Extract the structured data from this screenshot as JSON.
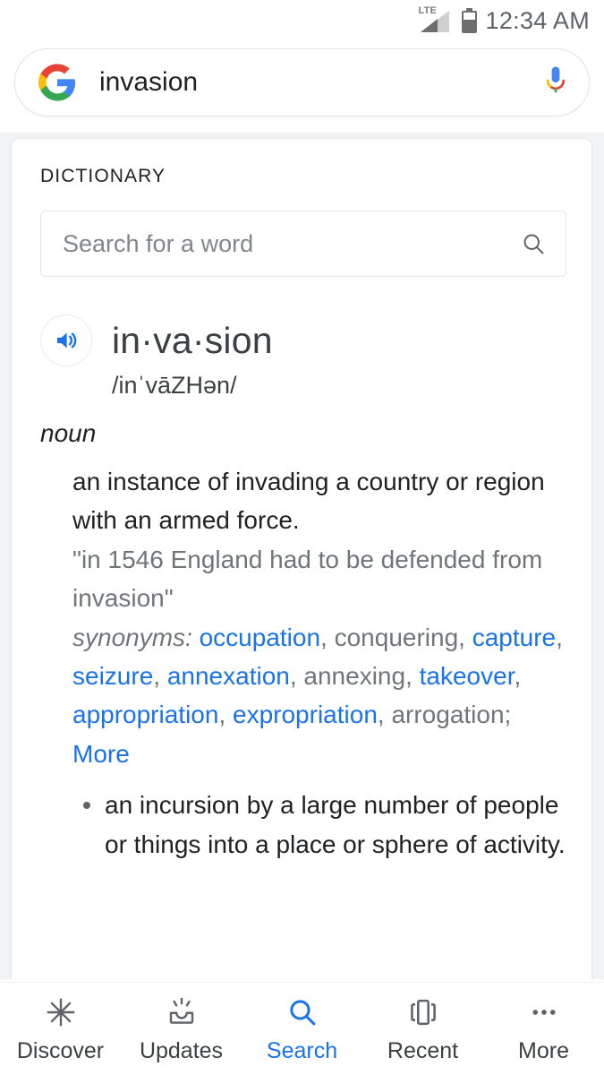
{
  "statusbar": {
    "network_label": "LTE",
    "time": "12:34 AM",
    "signal_icon": "signal-bars-icon",
    "battery_icon": "battery-icon"
  },
  "searchbar": {
    "logo_icon": "google-g-logo-icon",
    "query": "invasion",
    "mic_icon": "microphone-icon"
  },
  "card": {
    "section_label": "DICTIONARY",
    "word_search": {
      "placeholder": "Search for a word",
      "value": "",
      "search_icon": "search-icon"
    },
    "entry": {
      "speaker_icon": "speaker-audio-icon",
      "headword": "in·va·sion",
      "phonetic": "/inˈvāZHən/",
      "part_of_speech": "noun",
      "definition_1": "an instance of invading a country or region with an armed force.",
      "example_1": "\"in 1546 England had to be defended from invasion\"",
      "synonyms_label": "synonyms:",
      "synonyms": [
        {
          "text": "occupation",
          "link": true
        },
        {
          "text": "conquering",
          "link": false
        },
        {
          "text": "capture",
          "link": true
        },
        {
          "text": "seizure",
          "link": true
        },
        {
          "text": "annexation",
          "link": true
        },
        {
          "text": "annexing",
          "link": false
        },
        {
          "text": "takeover",
          "link": true
        },
        {
          "text": "appropriation",
          "link": true
        },
        {
          "text": "expropriation",
          "link": true
        },
        {
          "text": "arrogation",
          "link": false
        }
      ],
      "more_label": "More",
      "definition_2": "an incursion by a large number of people or things into a place or sphere of activity."
    }
  },
  "bottomnav": {
    "items": [
      {
        "label": "Discover",
        "icon": "asterisk-icon",
        "active": false
      },
      {
        "label": "Updates",
        "icon": "inbox-tray-icon",
        "active": false
      },
      {
        "label": "Search",
        "icon": "search-icon",
        "active": true
      },
      {
        "label": "Recent",
        "icon": "recent-cards-icon",
        "active": false
      },
      {
        "label": "More",
        "icon": "ellipsis-icon",
        "active": false
      }
    ]
  },
  "colors": {
    "accent_blue": "#1a73e8",
    "text_primary": "#202124",
    "text_secondary": "#70757a",
    "page_background": "#f1f3f4"
  }
}
